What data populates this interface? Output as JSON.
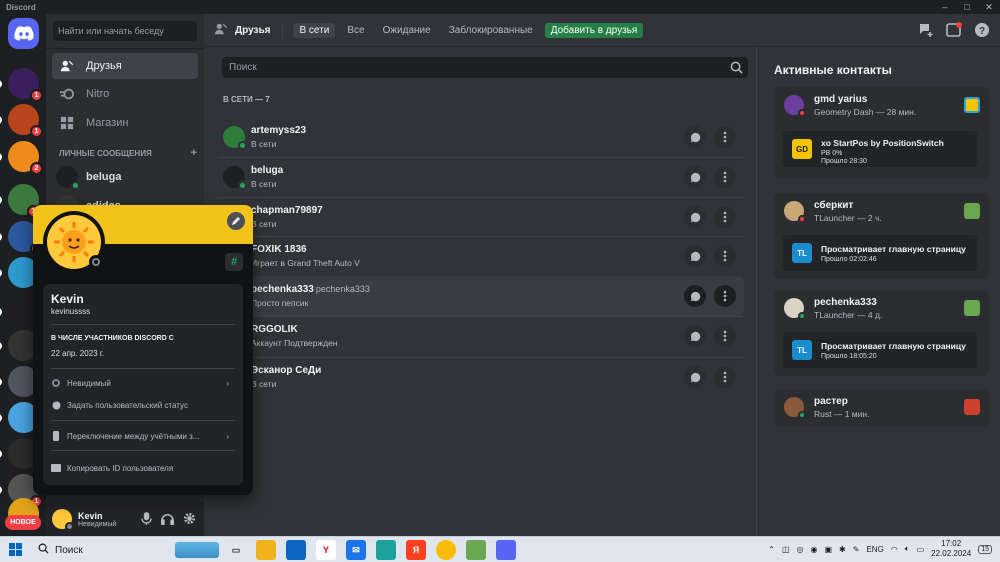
{
  "window": {
    "title": "Discord",
    "controls": [
      "–",
      "□",
      "✕"
    ]
  },
  "rail": {
    "badges": [
      "1",
      "1",
      "2",
      "13",
      "5",
      "1"
    ],
    "new_label": "НОВОЕ"
  },
  "sidebar": {
    "search_placeholder": "Найти или начать беседу",
    "nav": [
      {
        "label": "Друзья",
        "icon": "friends-icon"
      },
      {
        "label": "Nitro",
        "icon": "nitro-icon"
      },
      {
        "label": "Магазин",
        "icon": "shop-icon"
      }
    ],
    "dm_header": "ЛИЧНЫЕ СООБЩЕНИЯ",
    "dm_add": "+",
    "dms": [
      {
        "name": "beluga"
      },
      {
        "name": "adidas"
      }
    ]
  },
  "user": {
    "name": "Kevin",
    "status": "Невидимый"
  },
  "popout": {
    "display_name": "Kevin",
    "username": "kevinussss",
    "member_since_header": "В ЧИСЛЕ УЧАСТНИКОВ DISCORD С",
    "member_since": "22 апр. 2023 г.",
    "menu": [
      {
        "label": "Невидимый",
        "chevron": "›"
      },
      {
        "label": "Задать пользовательский статус",
        "chevron": ""
      },
      {
        "label": "Переключение между учётными з...",
        "chevron": "›"
      },
      {
        "label": "Копировать ID пользователя",
        "chevron": ""
      }
    ],
    "badge": "#"
  },
  "topbar": {
    "title": "Друзья",
    "tabs": [
      "В сети",
      "Все",
      "Ожидание",
      "Заблокированные"
    ],
    "add_friend": "Добавить в друзья"
  },
  "friends": {
    "search_placeholder": "Поиск",
    "header": "В СЕТИ — 7",
    "rows": [
      {
        "name": "artemyss23",
        "username": "",
        "status": "В сети",
        "dot": "#23a559",
        "avatar": "#2f7d3a"
      },
      {
        "name": "beluga",
        "username": "",
        "status": "В сети",
        "dot": "#23a559",
        "avatar": "#1e1f22"
      },
      {
        "name": "chapman79897",
        "username": "",
        "status": "В сети",
        "dot": "#23a559",
        "avatar": "#5865f2"
      },
      {
        "name": "FOXIK 1836",
        "username": "",
        "status": "Играет в Grand Theft Auto V",
        "dot": "#23a559",
        "avatar": "#c0392b"
      },
      {
        "name": "pechenka333",
        "username": "pechenka333",
        "status": "Просто пепсик",
        "dot": "#23a559",
        "avatar": "#d9d2c5"
      },
      {
        "name": "RGGOLIK",
        "username": "",
        "status": "Аккаунт Подтвержден",
        "dot": "#23a559",
        "avatar": "#7a5c3e"
      },
      {
        "name": "Эсканор СеДи",
        "username": "",
        "status": "В сети",
        "dot": "#23a559",
        "avatar": "#8e44ad"
      }
    ]
  },
  "active": {
    "header": "Активные контакты",
    "cards": [
      {
        "name": "gmd yarius",
        "game": "Geometry Dash — 28 мин.",
        "dot": "#f23f43",
        "sub": {
          "title": "xo StartPos by PositionSwitch",
          "line1": "PB 0%",
          "line2": "Прошло 28:30",
          "icon": "GD"
        }
      },
      {
        "name": "сберкит",
        "game": "TLauncher — 2 ч.",
        "dot": "#f23f43",
        "sub": {
          "title": "Просматривает главную страницу",
          "line1": "Прошло 02:02:46",
          "line2": "",
          "icon": "TL"
        }
      },
      {
        "name": "pechenka333",
        "game": "TLauncher — 4 д.",
        "dot": "#23a559",
        "sub": {
          "title": "Просматривает главную страницу",
          "line1": "Прошло 18:05:20",
          "line2": "",
          "icon": "TL"
        }
      },
      {
        "name": "растер",
        "game": "Rust — 1 мин.",
        "dot": "#23a559",
        "sub": null
      }
    ]
  },
  "taskbar": {
    "search": "Поиск",
    "lang": "ENG",
    "time": "17:02",
    "date": "22.02.2024",
    "notif_count": "15"
  },
  "colors": {
    "accent": "#5865f2",
    "online": "#23a559",
    "dnd": "#f23f43",
    "add_friend": "#248046"
  }
}
